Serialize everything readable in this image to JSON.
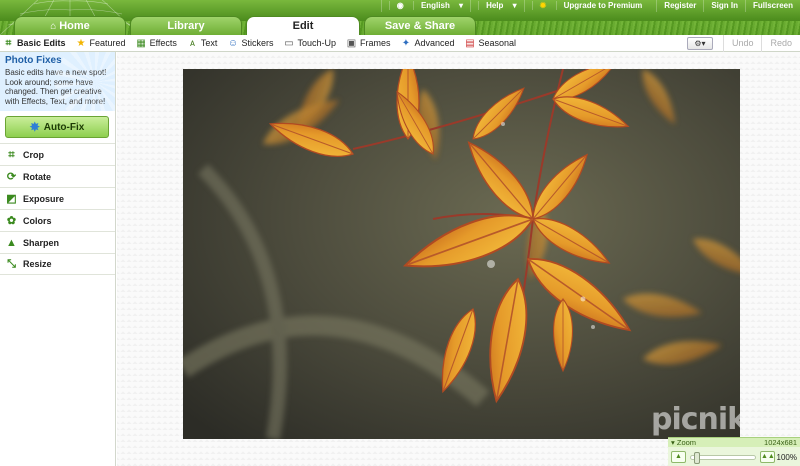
{
  "header": {
    "tabs": [
      {
        "label": "Home",
        "active": false
      },
      {
        "label": "Library",
        "active": false
      },
      {
        "label": "Edit",
        "active": true
      },
      {
        "label": "Save & Share",
        "active": false
      }
    ],
    "topnav": {
      "language": "English",
      "help": "Help",
      "upgrade": "Upgrade to Premium",
      "register": "Register",
      "signin": "Sign In",
      "fullscreen": "Fullscreen"
    }
  },
  "toolbar": {
    "items": [
      {
        "label": "Basic Edits",
        "icon": "crop-icon",
        "active": true
      },
      {
        "label": "Featured",
        "icon": "star-icon"
      },
      {
        "label": "Effects",
        "icon": "film-icon"
      },
      {
        "label": "Text",
        "icon": "text-icon"
      },
      {
        "label": "Stickers",
        "icon": "smiley-icon"
      },
      {
        "label": "Touch-Up",
        "icon": "brush-icon"
      },
      {
        "label": "Frames",
        "icon": "frame-icon"
      },
      {
        "label": "Advanced",
        "icon": "wand-icon"
      },
      {
        "label": "Seasonal",
        "icon": "calendar-icon"
      }
    ],
    "undo": "Undo",
    "redo": "Redo"
  },
  "sidebar": {
    "fixes_title": "Photo Fixes",
    "fixes_text": "Basic edits have a new spot! Look around; some have changed. Then get creative with Effects, Text, and more!",
    "autofix": "Auto-Fix",
    "menu": [
      {
        "label": "Crop",
        "icon": "crop-icon"
      },
      {
        "label": "Rotate",
        "icon": "rotate-icon"
      },
      {
        "label": "Exposure",
        "icon": "exposure-icon"
      },
      {
        "label": "Colors",
        "icon": "colors-icon"
      },
      {
        "label": "Sharpen",
        "icon": "sharpen-icon"
      },
      {
        "label": "Resize",
        "icon": "resize-icon"
      }
    ]
  },
  "canvas": {
    "logo": "picnik"
  },
  "zoom": {
    "label": "Zoom",
    "dimensions": "1024x681",
    "percent": "100%",
    "level": 0.05
  },
  "colors": {
    "brand_green": "#5fa526",
    "accent_blue": "#1f5fa6"
  }
}
